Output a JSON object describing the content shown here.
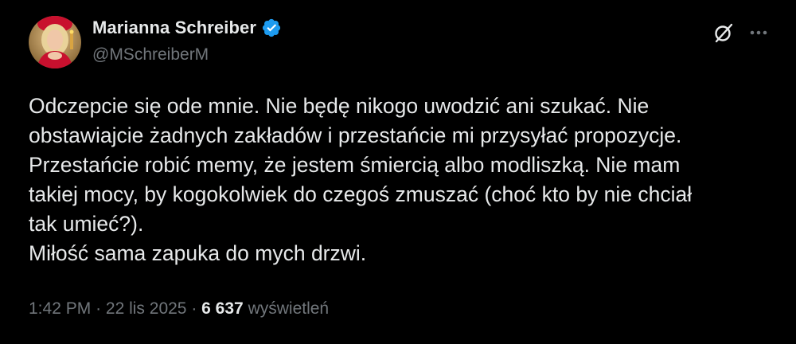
{
  "author": {
    "display_name": "Marianna Schreiber",
    "handle": "@MSchreiberM",
    "verified": true,
    "verified_color": "#1d9bf0"
  },
  "header_icons": {
    "grok": "grok-icon",
    "more": "more-icon"
  },
  "tweet": {
    "lines": [
      "Odczepcie się ode mnie. Nie będę nikogo uwodzić ani szukać. Nie",
      "obstawiajcie żadnych zakładów i przestańcie mi przysyłać propozycje.",
      "Przestańcie robić memy, że jestem śmiercią albo modliszką. Nie mam",
      "takiej mocy, by kogokolwiek do czegoś zmuszać (choć kto by nie chciał",
      "tak umieć?).",
      "Miłość sama zapuka do mych drzwi."
    ]
  },
  "meta": {
    "time": "1:42 PM",
    "separator": "·",
    "date": "22 lis 2025",
    "views_count": "6 637",
    "views_label": "wyświetleń"
  },
  "colors": {
    "background": "#000000",
    "text_primary": "#e7e9ea",
    "text_secondary": "#71767b"
  }
}
